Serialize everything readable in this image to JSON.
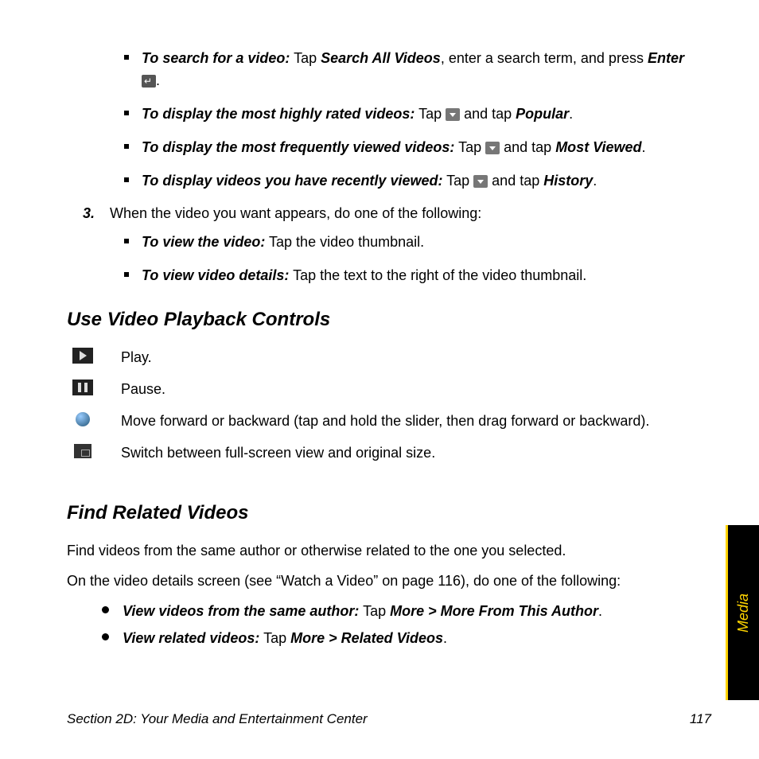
{
  "bullets1": [
    {
      "lead": "To search for a video:",
      "pre": " Tap ",
      "bold1": "Search All Videos",
      "mid": ", enter a search term, and press ",
      "bold2": "Enter",
      "hasEnterIcon": true,
      "tail": "."
    },
    {
      "lead": "To display the most highly rated videos:",
      "pre": " Tap ",
      "hasDdIcon": true,
      "mid": " and tap ",
      "bold2": "Popular",
      "tail": "."
    },
    {
      "lead": "To display the most frequently viewed videos:",
      "pre": " Tap ",
      "hasDdIcon": true,
      "mid": " and tap ",
      "bold2": "Most Viewed",
      "tail": "."
    },
    {
      "lead": "To display videos you have recently viewed:",
      "pre": " Tap ",
      "hasDdIcon": true,
      "mid": " and tap ",
      "bold2": "History",
      "tail": "."
    }
  ],
  "step": {
    "num": "3.",
    "text": "When the video you want appears, do one of the following:"
  },
  "bullets2": [
    {
      "lead": "To view the video:",
      "text": " Tap the video thumbnail."
    },
    {
      "lead": "To view video details:",
      "text": " Tap the text to the right of the video thumbnail."
    }
  ],
  "h_controls": "Use Video Playback Controls",
  "controls": [
    {
      "icon": "play",
      "text": "Play."
    },
    {
      "icon": "pause",
      "text": "Pause."
    },
    {
      "icon": "slider",
      "text": "Move forward or backward (tap and hold the slider, then drag forward or backward)."
    },
    {
      "icon": "fullscreen",
      "text": "Switch between full-screen view and original size."
    }
  ],
  "h_related": "Find Related Videos",
  "related_p1": "Find videos from the same author or otherwise related to the one you selected.",
  "related_p2": "On the video details screen (see “Watch a Video” on page 116), do one of the following:",
  "related_bullets": [
    {
      "lead": "View videos from the same author:",
      "pre": " Tap ",
      "b1": "More",
      "gt": " > ",
      "b2": "More From This Author",
      "tail": "."
    },
    {
      "lead": "View related videos:",
      "pre": " Tap ",
      "b1": "More",
      "gt": " > ",
      "b2": "Related Videos",
      "tail": "."
    }
  ],
  "footer_section": "Section 2D: Your Media and Entertainment Center",
  "footer_page": "117",
  "side_tab": "Media"
}
